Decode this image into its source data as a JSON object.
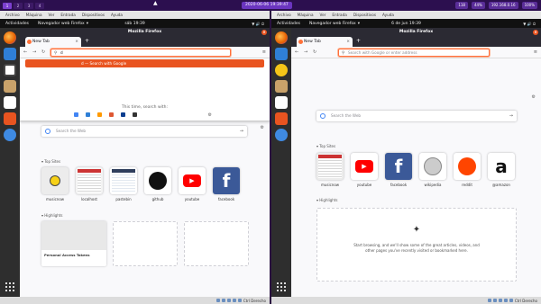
{
  "host": {
    "workspaces": [
      "1",
      "2",
      "3",
      "4"
    ],
    "clock": "2020-06-06 19:39:47",
    "right_items": [
      "118",
      "44%",
      "192.168.0.16",
      "100%"
    ]
  },
  "vm_menu": [
    "Archivo",
    "Máquina",
    "Ver",
    "Entrada",
    "Dispositivos",
    "Ayuda"
  ],
  "left_vm": {
    "topbar": {
      "activities": "Actividades",
      "app": "Navegador web Firefox",
      "clock": "sáb 19:39"
    },
    "window_title": "Mozilla Firefox",
    "tab_title": "New Tab",
    "url_value": "d",
    "dropdown": {
      "suggestion": "d — Search with Google",
      "this_time": "This time, search with:"
    },
    "search_placeholder": "Search the Web",
    "top_sites_label": "Top Sites",
    "top_sites": [
      "musicnow",
      "localhost",
      "pastebin",
      "github",
      "youtube",
      "facebook"
    ],
    "highlights_label": "Highlights",
    "highlight_card_title": "Personal Access Tokens",
    "status_text": "Ctrl Derecho"
  },
  "right_vm": {
    "topbar": {
      "activities": "Actividades",
      "app": "Navegador web Firefox",
      "clock": "6 de jun 19:39"
    },
    "window_title": "Mozilla Firefox",
    "tab_title": "New Tab",
    "url_placeholder": "Search with Google or enter address",
    "search_placeholder": "Search the Web",
    "top_sites_label": "Top Sites",
    "top_sites": [
      "musicnow",
      "youtube",
      "facebook",
      "wikipedia",
      "reddit",
      "@amazon"
    ],
    "highlights_label": "Highlights",
    "highlights_empty": "Start browsing, and we'll show some of the great articles, videos, and other pages you've recently visited or bookmarked here.",
    "status_text": "Ctrl Derecho"
  },
  "colors": {
    "host_bg": "#2c0f4f",
    "ubuntu_orange": "#e95420",
    "firefox_dark": "#2b2a33"
  }
}
